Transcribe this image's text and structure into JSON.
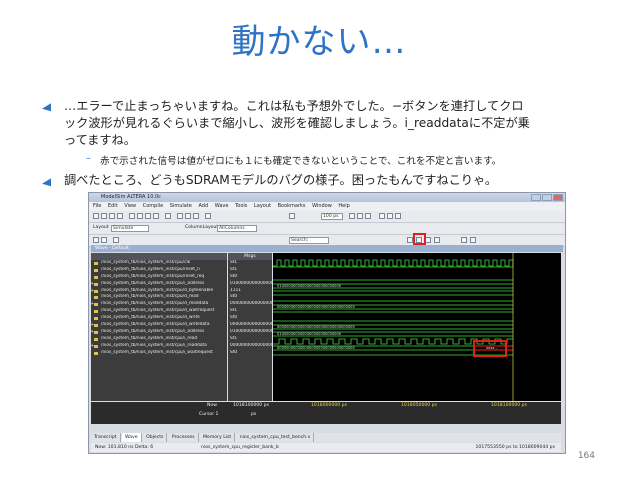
{
  "slide": {
    "title": "動かない…",
    "bullet1_line1": "…エラーで止まっちゃいますね。これは私も予想外でした。−ボタンを連打してクロ",
    "bullet1_line2": "ック波形が見れるぐらいまで縮小し、波形を確認しましょう。i_readdataに不定が乗",
    "bullet1_line3": "ってますね。",
    "sub_bullet": "赤で示された信号は値がゼロにも１にも確定できないということで、これを不定と言います。",
    "bullet2": "調べたところ、どうもSDRAMモデルのバグの様子。困ったもんですねこりゃ。",
    "page_number": "164",
    "accent_color": "#2f73c6"
  },
  "window": {
    "title": "ModelSim ALTERA 10.0c",
    "menu": [
      "File",
      "Edit",
      "View",
      "Compile",
      "Simulate",
      "Add",
      "Wave",
      "Tools",
      "Layout",
      "Bookmarks",
      "Window",
      "Help"
    ],
    "layout_label": "Layout",
    "layout_value": "Simulate",
    "column_layout_label": "ColumnLayout",
    "column_layout_value": "AllColumns",
    "time_value": "100 ps",
    "search_placeholder": "Search:",
    "wave_header": "Wave - Default",
    "msgs_header": "Msgs",
    "signals": [
      {
        "name": "/nios_system_tb/nios_system_inst/cpu/clk",
        "value": "St1"
      },
      {
        "name": "/nios_system_tb/nios_system_inst/cpu/reset_n",
        "value": "St1"
      },
      {
        "name": "/nios_system_tb/nios_system_inst/cpu/reset_req",
        "value": "St0"
      },
      {
        "name": "/nios_system_tb/nios_system_inst/cpu/i_address",
        "value": "0100000000000000..."
      },
      {
        "name": "/nios_system_tb/nios_system_inst/cpu/d_byteenable",
        "value": "1111"
      },
      {
        "name": "/nios_system_tb/nios_system_inst/cpu/d_read",
        "value": "St0"
      },
      {
        "name": "/nios_system_tb/nios_system_inst/cpu/d_readdata",
        "value": "0000000000000000..."
      },
      {
        "name": "/nios_system_tb/nios_system_inst/cpu/d_waitrequest",
        "value": "St1"
      },
      {
        "name": "/nios_system_tb/nios_system_inst/cpu/d_write",
        "value": "St0"
      },
      {
        "name": "/nios_system_tb/nios_system_inst/cpu/d_writedata",
        "value": "0000000000000000..."
      },
      {
        "name": "/nios_system_tb/nios_system_inst/cpu/i_address",
        "value": "0100000000000000..."
      },
      {
        "name": "/nios_system_tb/nios_system_inst/cpu/i_read",
        "value": "St1"
      },
      {
        "name": "/nios_system_tb/nios_system_inst/cpu/i_readdata",
        "value": "0000000000000000..."
      },
      {
        "name": "/nios_system_tb/nios_system_inst/cpu/i_waitrequest",
        "value": "St0"
      }
    ],
    "bus_values": [
      "0100000000000000000000000000",
      "0000000000000000000000000000000000",
      "0000000000000000000000000000000000",
      "0100000000000000000000000000",
      "0000000000000000000000000000000000"
    ],
    "undefined_value": "xxxx...",
    "now_label": "Now",
    "now_value": "1018100000 ps",
    "cursor_label": "Cursor 1",
    "cursor_value": "ps",
    "timeline": [
      "1018000000 ps",
      "1018050000 ps",
      "1018100000 ps"
    ],
    "tabs": [
      "Transcript",
      "Wave",
      "Objects",
      "Processes",
      "Memory List",
      "nios_system_cpu_test_bench.v"
    ],
    "status_now": "Now: 101,810 ns  Delta: 6",
    "status_file": "nios_system_cpu_register_bank_b",
    "status_range": "1017553550 ps to 1018609044 ps"
  }
}
